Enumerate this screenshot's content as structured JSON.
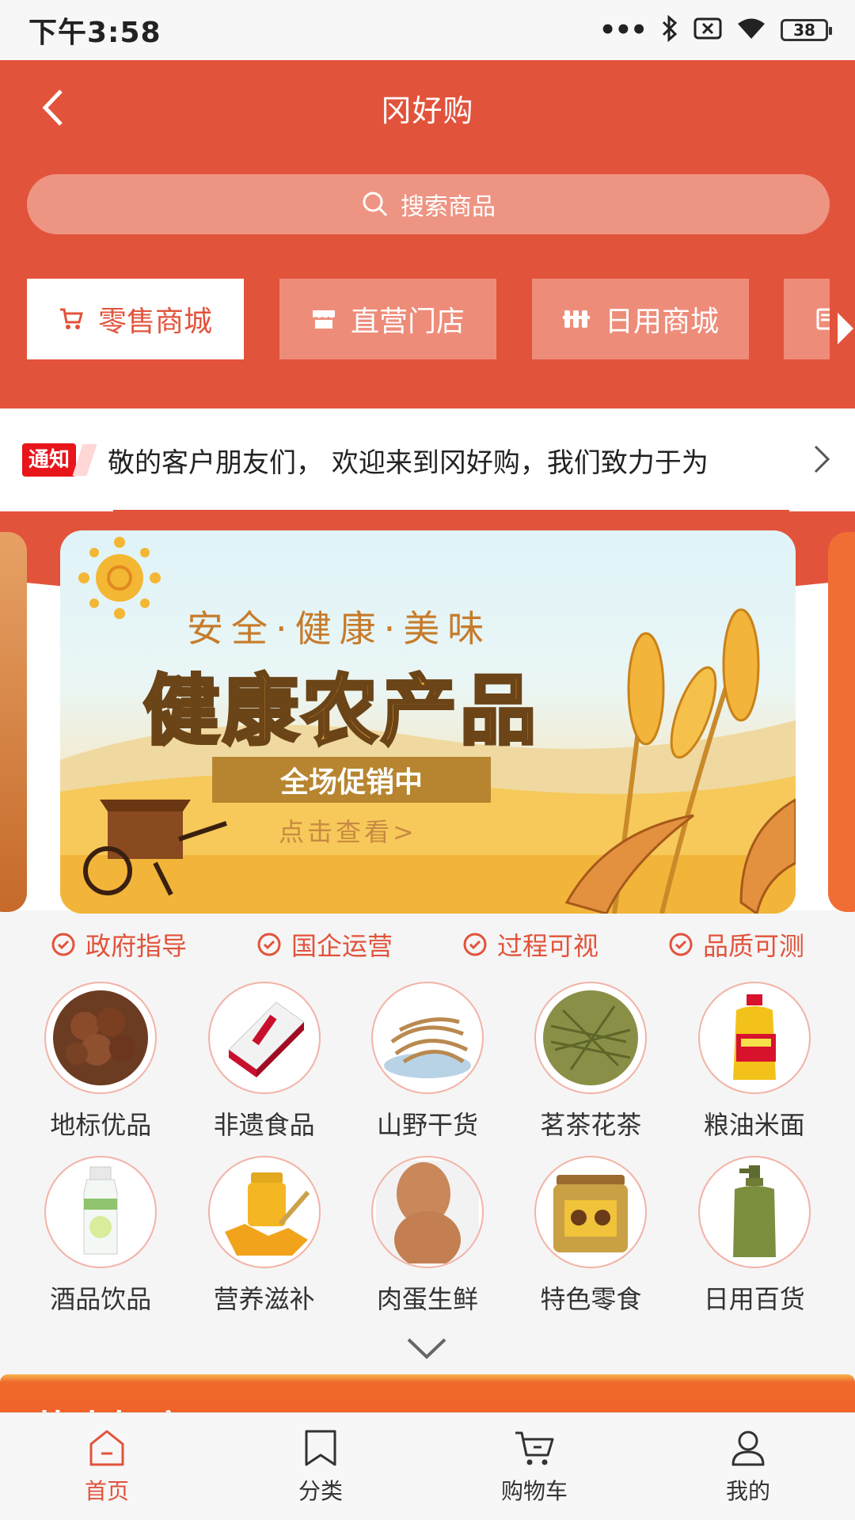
{
  "status_bar": {
    "time": "下午3:58",
    "dots": "•••",
    "battery_level": "38"
  },
  "header": {
    "title": "冈好购"
  },
  "search": {
    "placeholder": "搜索商品"
  },
  "tabs": [
    {
      "label": "零售商城",
      "icon": "cart-icon",
      "active": true
    },
    {
      "label": "直营门店",
      "icon": "store-icon",
      "active": false
    },
    {
      "label": "日用商城",
      "icon": "daily-icon",
      "active": false
    },
    {
      "label": "",
      "icon": "document-icon",
      "active": false
    }
  ],
  "notice": {
    "badge": "通知",
    "text": "敬的客户朋友们， 欢迎来到冈好购，我们致力于为"
  },
  "banner": {
    "tagline": "安全·健康·美味",
    "title": "健康农产品",
    "promo": "全场促销中",
    "link": "点击查看>"
  },
  "features": [
    "政府指导",
    "国企运营",
    "过程可视",
    "品质可测"
  ],
  "categories": [
    {
      "label": "地标优品",
      "icon": "chestnut-icon"
    },
    {
      "label": "非遗食品",
      "icon": "gift-box-icon"
    },
    {
      "label": "山野干货",
      "icon": "mushroom-icon"
    },
    {
      "label": "茗茶花茶",
      "icon": "tea-leaves-icon"
    },
    {
      "label": "粮油米面",
      "icon": "oil-bottle-icon"
    },
    {
      "label": "酒品饮品",
      "icon": "drink-bottle-icon"
    },
    {
      "label": "营养滋补",
      "icon": "honey-icon"
    },
    {
      "label": "肉蛋生鲜",
      "icon": "eggs-icon"
    },
    {
      "label": "特色零食",
      "icon": "snack-jar-icon"
    },
    {
      "label": "日用百货",
      "icon": "lotion-bottle-icon"
    }
  ],
  "hot_section": {
    "title": "热卖好店"
  },
  "bottom_nav": [
    {
      "label": "首页",
      "icon": "home-icon",
      "active": true
    },
    {
      "label": "分类",
      "icon": "bookmark-icon",
      "active": false
    },
    {
      "label": "购物车",
      "icon": "cart-icon",
      "active": false
    },
    {
      "label": "我的",
      "icon": "user-icon",
      "active": false
    }
  ],
  "colors": {
    "brand": "#e2533b",
    "notice_badge": "#e8151b"
  }
}
